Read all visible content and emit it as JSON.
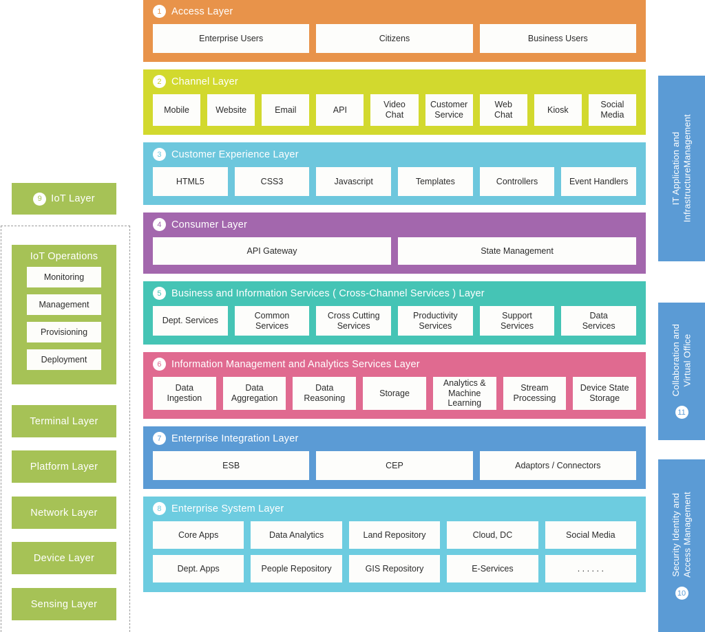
{
  "colors": {
    "access": "#E8934A",
    "channel": "#D2D92E",
    "customer_experience": "#6DC7DD",
    "consumer": "#A367AD",
    "business_info_services": "#45C4B5",
    "info_mgmt_analytics": "#E06A90",
    "enterprise_integration": "#5B9BD5",
    "enterprise_system": "#6DCCE0",
    "iot_green": "#A6C256",
    "vertical_panel_blue": "#5B9BD5",
    "cell_background": "#FDFDFB",
    "dashed_border": "#9A9A9A"
  },
  "center_layers": [
    {
      "badge": "1",
      "title": "Access Layer",
      "rows": [
        [
          "Enterprise Users",
          "Citizens",
          "Business Users"
        ]
      ]
    },
    {
      "badge": "2",
      "title": "Channel Layer",
      "rows": [
        [
          "Mobile",
          "Website",
          "Email",
          "API",
          "Video\nChat",
          "Customer\nService",
          "Web\nChat",
          "Kiosk",
          "Social\nMedia"
        ]
      ]
    },
    {
      "badge": "3",
      "title": "Customer Experience Layer",
      "rows": [
        [
          "HTML5",
          "CSS3",
          "Javascript",
          "Templates",
          "Controllers",
          "Event Handlers"
        ]
      ]
    },
    {
      "badge": "4",
      "title": "Consumer Layer",
      "rows": [
        [
          "API Gateway",
          "State Management"
        ]
      ]
    },
    {
      "badge": "5",
      "title": "Business and Information Services ( Cross-Channel Services ) Layer",
      "rows": [
        [
          "Dept. Services",
          "Common\nServices",
          "Cross Cutting\nServices",
          "Productivity\nServices",
          "Support\nServices",
          "Data\nServices"
        ]
      ]
    },
    {
      "badge": "6",
      "title": "Information Management and Analytics Services Layer",
      "rows": [
        [
          "Data\nIngestion",
          "Data\nAggregation",
          "Data\nReasoning",
          "Storage",
          "Analytics &\nMachine\nLearning",
          "Stream\nProcessing",
          "Device State\nStorage"
        ]
      ]
    },
    {
      "badge": "7",
      "title": "Enterprise Integration Layer",
      "rows": [
        [
          "ESB",
          "CEP",
          "Adaptors / Connectors"
        ]
      ]
    },
    {
      "badge": "8",
      "title": "Enterprise System Layer",
      "rows": [
        [
          "Core Apps",
          "Data Analytics",
          "Land Repository",
          "Cloud, DC",
          "Social Media"
        ],
        [
          "Dept. Apps",
          "People Repository",
          "GIS Repository",
          "E-Services",
          ". . . . . ."
        ]
      ]
    }
  ],
  "iot": {
    "header": {
      "badge": "9",
      "label": "IoT Layer"
    },
    "operations": {
      "title": "IoT Operations",
      "items": [
        "Monitoring",
        "Management",
        "Provisioning",
        "Deployment"
      ]
    },
    "stack": [
      "Terminal Layer",
      "Platform Layer",
      "Network Layer",
      "Device Layer",
      "Sensing Layer"
    ]
  },
  "vertical_panels": [
    {
      "text": "IT Application and\nInfrastructureManagement",
      "badge": ""
    },
    {
      "text": "Collaboration and\nVirtual Office",
      "badge": "11"
    },
    {
      "text": "Security Identity and\nAccess Management",
      "badge": "10"
    }
  ]
}
